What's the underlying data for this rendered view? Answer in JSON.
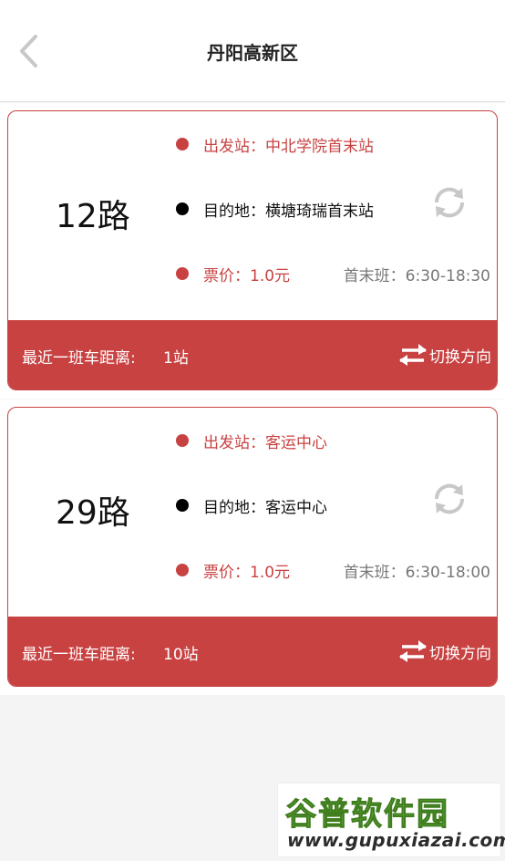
{
  "header": {
    "title": "丹阳高新区",
    "back_icon": "chevron-left-icon"
  },
  "colors": {
    "accent": "#c94242",
    "background": "#f4f4f4",
    "muted_text": "#777777"
  },
  "routes": [
    {
      "route_no": "12路",
      "departure": "出发站：中北学院首末站",
      "destination": "目的地：横塘琦瑞首末站",
      "fare": "票价：1.0元",
      "schedule": "首末班：6:30-18:30",
      "next_bus_label": "最近一班车距离:",
      "next_bus_value": "1站",
      "switch_label": "切换方向",
      "refresh_icon": "refresh-icon",
      "switch_icon": "swap-arrows-icon"
    },
    {
      "route_no": "29路",
      "departure": "出发站：客运中心",
      "destination": "目的地：客运中心",
      "fare": "票价：1.0元",
      "schedule": "首末班：6:30-18:00",
      "next_bus_label": "最近一班车距离:",
      "next_bus_value": "10站",
      "switch_label": "切换方向",
      "refresh_icon": "refresh-icon",
      "switch_icon": "swap-arrows-icon"
    }
  ],
  "watermark": {
    "brand": "谷普软件园",
    "url": "www.gupuxiazai.com"
  }
}
